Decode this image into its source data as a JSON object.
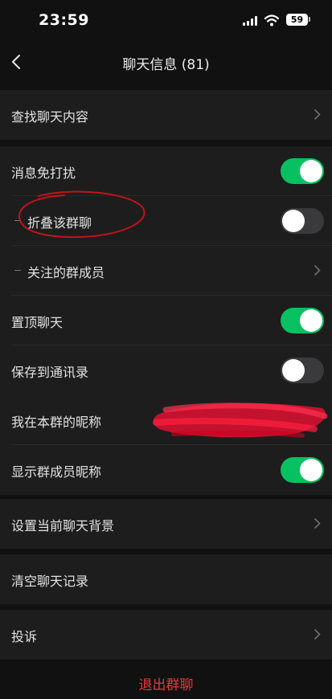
{
  "status_bar": {
    "time": "23:59",
    "battery": "59"
  },
  "nav": {
    "title": "聊天信息 (81)"
  },
  "rows": {
    "search": {
      "label": "查找聊天内容"
    },
    "mute": {
      "label": "消息免打扰",
      "on": true
    },
    "fold": {
      "label": "折叠该群聊",
      "on": false
    },
    "followed": {
      "label": "关注的群成员"
    },
    "pin": {
      "label": "置顶聊天",
      "on": true
    },
    "save": {
      "label": "保存到通讯录",
      "on": false
    },
    "nickname": {
      "label": "我在本群的昵称"
    },
    "show_nicknames": {
      "label": "显示群成员昵称",
      "on": true
    },
    "background": {
      "label": "设置当前聊天背景"
    },
    "clear": {
      "label": "清空聊天记录"
    },
    "report": {
      "label": "投诉"
    }
  },
  "exit": {
    "label": "退出群聊"
  },
  "colors": {
    "toggle_on": "#07c160",
    "toggle_off": "#3a3a3c",
    "exit": "#e4393c",
    "annotation": "#c0141c"
  }
}
